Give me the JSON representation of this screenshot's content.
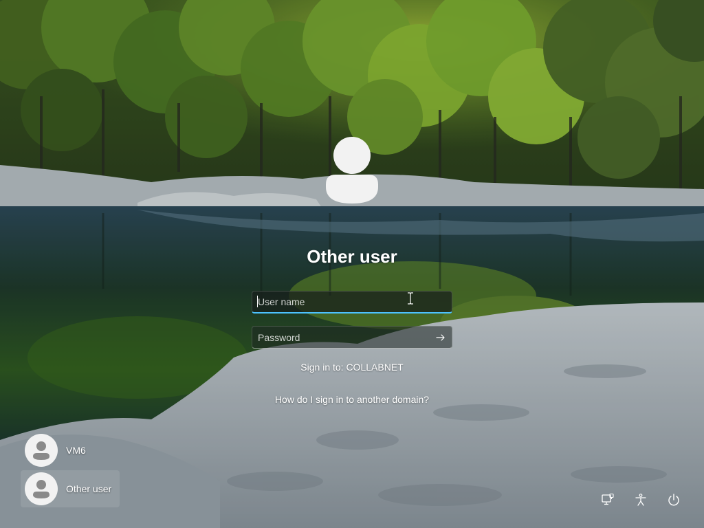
{
  "colors": {
    "accent": "#4cc2ff",
    "text": "#ffffff"
  },
  "signin": {
    "avatar_icon": "user-avatar-icon",
    "title": "Other user",
    "username_placeholder": "User name",
    "username_value": "",
    "password_placeholder": "Password",
    "password_value": "",
    "submit_icon": "arrow-right-icon",
    "domain_text": "Sign in to: COLLABNET",
    "domain_help_link": "How do I sign in to another domain?"
  },
  "users": [
    {
      "name": "VM6",
      "selected": false,
      "icon": "user-avatar-icon"
    },
    {
      "name": "Other user",
      "selected": true,
      "icon": "user-avatar-icon"
    }
  ],
  "corner_buttons": [
    {
      "icon": "network-icon"
    },
    {
      "icon": "accessibility-icon"
    },
    {
      "icon": "power-icon"
    }
  ]
}
